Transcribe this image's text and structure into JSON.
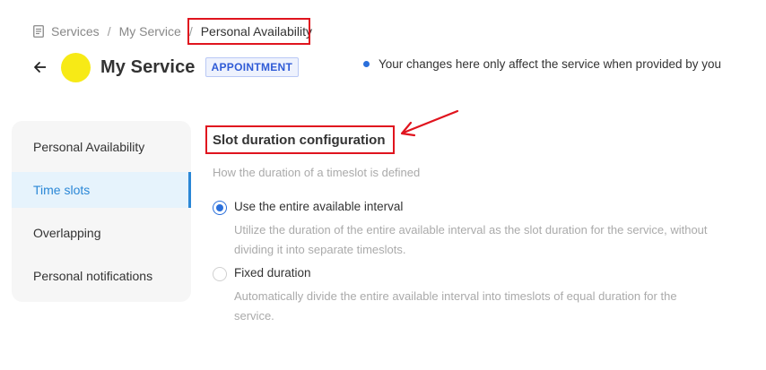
{
  "breadcrumb": {
    "icon": "document-icon",
    "items": [
      "Services",
      "My Service",
      "Personal Availability"
    ],
    "separator": "/"
  },
  "header": {
    "back_icon": "back-arrow-icon",
    "avatar_color": "#f7ea16",
    "title": "My Service",
    "badge": "APPOINTMENT"
  },
  "notice": {
    "text": "Your changes here only affect the service when provided by you"
  },
  "sidebar": {
    "items": [
      {
        "label": "Personal Availability",
        "active": false
      },
      {
        "label": "Time slots",
        "active": true
      },
      {
        "label": "Overlapping",
        "active": false
      },
      {
        "label": "Personal notifications",
        "active": false
      }
    ]
  },
  "section": {
    "title": "Slot duration configuration",
    "description": "How the duration of a timeslot is defined",
    "options": [
      {
        "label": "Use the entire available interval",
        "description": "Utilize the duration of the entire available interval as the slot duration for the service, without dividing it into separate timeslots.",
        "selected": true
      },
      {
        "label": "Fixed duration",
        "description": "Automatically divide the entire available interval into timeslots of equal duration for the service.",
        "selected": false
      }
    ]
  },
  "colors": {
    "accent": "#2a6fdb",
    "active_nav": "#2a87d6",
    "annotation": "#e0141e"
  }
}
